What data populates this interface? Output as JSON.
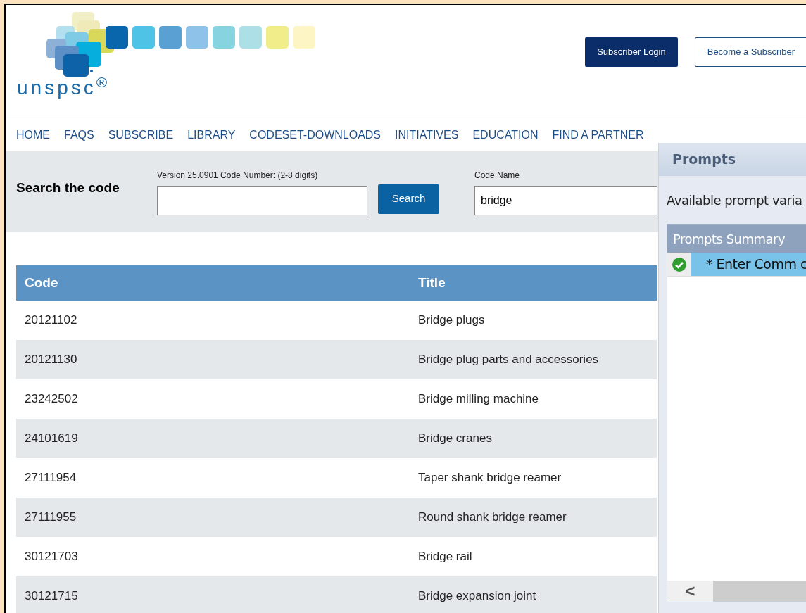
{
  "logo": {
    "wordmark": "unspsc$^{®}$"
  },
  "header_buttons": [
    {
      "label": "Subscriber Login",
      "kind": "filled"
    },
    {
      "label": "Become a Subscriber",
      "kind": "outline"
    }
  ],
  "nav": [
    "HOME",
    "FAQS",
    "SUBSCRIBE",
    "LIBRARY",
    "CODESET-DOWNLOADS",
    "INITIATIVES",
    "EDUCATION",
    "FIND A PARTNER"
  ],
  "search": {
    "title": "Search the code",
    "code_label": "Version 25.0901 Code Number: (2-8 digits)",
    "button": "Search",
    "name_label": "Code Name",
    "name_value": "bridge"
  },
  "table": {
    "columns": [
      "Code",
      "Title"
    ],
    "rows": [
      [
        "20121102",
        "Bridge plugs"
      ],
      [
        "20121130",
        "Bridge plug parts and accessories"
      ],
      [
        "23242502",
        "Bridge milling machine"
      ],
      [
        "24101619",
        "Bridge cranes"
      ],
      [
        "27111954",
        "Taper shank bridge reamer"
      ],
      [
        "27111955",
        "Round shank bridge reamer"
      ],
      [
        "30121703",
        "Bridge rail"
      ],
      [
        "30121715",
        "Bridge expansion joint"
      ]
    ]
  },
  "prompts_panel": {
    "title": "Prompts",
    "intro": "Available prompt varia",
    "summary_title": "Prompts Summary",
    "items": [
      {
        "label": "* Enter Comm c",
        "done": true,
        "selected": true
      }
    ],
    "scroll_left": "<"
  }
}
